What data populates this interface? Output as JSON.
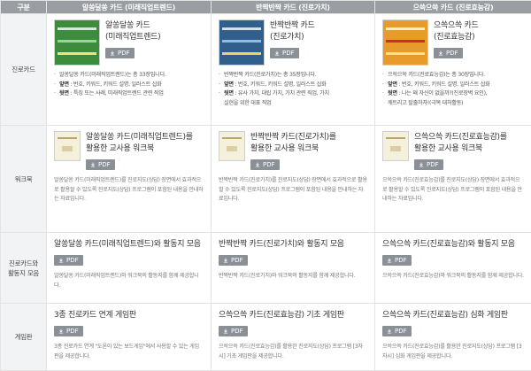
{
  "header": {
    "col0": "구분",
    "col1": "알쏭달쏭 카드 (미래직업트렌드)",
    "col2": "반짝반짝 카드 (진로가치)",
    "col3": "으쓱으쓱 카드 (진로효능감)"
  },
  "pdf_label": "PDF",
  "rows": [
    {
      "label": "진로카드",
      "cells": [
        {
          "title1": "알쏭달쏭 카드",
          "title2": "(미래직업트렌드)",
          "intro": "알쏭달쏭 카드(미래직업트렌드)는 총 33장입니다.",
          "front_k": "앞면",
          "front_v": " : 번호, 키워드, 키워드 설명, 일러스트 삽화",
          "back_k": "뒷면",
          "back_v": " : 특징 또는 사례, 미래직업트렌드 관련 직업"
        },
        {
          "title1": "반짝반짝 카드",
          "title2": "(진로가치)",
          "intro": "반짝반짝 카드(진로가치)는 총 35장입니다.",
          "front_k": "앞면",
          "front_v": " : 번호, 키워드, 키워드 설명, 일러스트 삽화",
          "back_k": "뒷면",
          "back_v": " : 유사 가치, 대립 가치, 가치 관련 직업, 가치",
          "back_v2": "실현을 위한 대표 직업"
        },
        {
          "title1": "으쓱으쓱 카드",
          "title2": "(진로효능감)",
          "intro": "으쓱으쓱 카드(진로효능감)는 총 30장입니다.",
          "front_k": "앞면",
          "front_v": " : 번호, 키워드, 키워드 설명, 일러스트 삽화",
          "back_k": "뒷면",
          "back_v": " : 나는 왜 자신이 없을까?(진로장벽 요인),",
          "back_v2": "깨트리고 탈출하자!(극복 대처활동)"
        }
      ]
    },
    {
      "label": "워크북",
      "cells": [
        {
          "title1": "알쏭달쏭 카드(미래직업트렌드)를",
          "title2": "활용한 교사용 워크북",
          "body": "알쏭달쏭 카드(미래직업트렌드)를 진로지도(상담) 장면에서 효과적으로 활용할 수 있도록 진로지도(상담) 프로그램이 포함된 내용을 안내하는 자료입니다."
        },
        {
          "title1": "반짝반짝 카드(진로가치)를",
          "title2": "활용한 교사용 워크북",
          "body": "반짝반짝 카드(진로가치)를 진로지도(상담) 장면에서 효과적으로 활용할 수 있도록 진로지도(상담) 프로그램이 포함된 내용을 안내하는 자료입니다."
        },
        {
          "title1": "으쓱으쓱 카드(진로효능감)를",
          "title2": "활용한 교사용 워크북",
          "body": "으쓱으쓱 카드(진로효능감)를 진로지도(상담) 장면에서 효과적으로 활용할 수 있도록 진로지도(상담) 프로그램이 포함된 내용을 안내하는 자료입니다."
        }
      ]
    },
    {
      "label1": "진로카드와",
      "label2": "활동지 모음",
      "cells": [
        {
          "title": "알쏭달쏭 카드(미래직업트렌드)와 활동지 모음",
          "body": "알쏭달쏭 카드(미래직업트렌드)와 워크북의 활동지를 함께 제공합니다."
        },
        {
          "title": "반짝반짝 카드(진로가치)와 활동지 모음",
          "body": "반짝반짝 카드(진로가치)와 워크북의 활동지를 함께 제공합니다."
        },
        {
          "title": "으쓱으쓱 카드(진로효능감)와 활동지 모음",
          "body": "으쓱으쓱 카드(진로효능감)와 워크북의 활동지를 함께 제공합니다."
        }
      ]
    },
    {
      "label": "게임판",
      "cells": [
        {
          "title": "3종 진로카드 연계 게임판",
          "body": "3종 진로카드 연계 \"도론이 있는 보드게임\"에서 사용할 수 있는 게임판을 제공합니다."
        },
        {
          "title": "으쓱으쓱 카드(진로효능감) 기초 게임판",
          "body": "으쓱으쓱 카드(진로효능감)를 활용한 진로지도(상담) 프로그램 [3차시] 기초 게임판을 제공합니다."
        },
        {
          "title": "으쓱으쓱 카드(진로효능감) 심화 게임판",
          "body": "으쓱으쓱 카드(진로효능감)를 활용한 진로지도(상담) 프로그램 [3차시] 심화 게임판을 제공합니다."
        }
      ]
    }
  ],
  "colors": {
    "header_bg": "#9a9ea3",
    "rowhead_bg": "#f2f3f5",
    "button_bg": "#8a9096"
  },
  "icons": {
    "pdf": "download-icon"
  }
}
